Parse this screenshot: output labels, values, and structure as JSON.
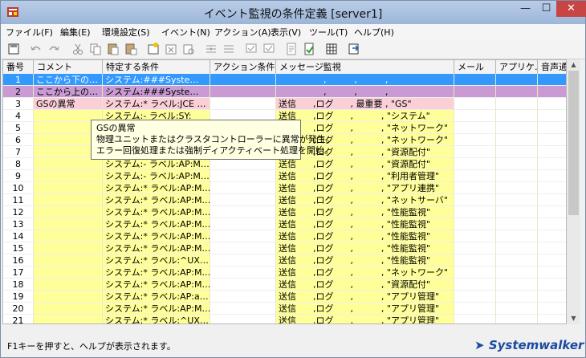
{
  "window": {
    "title": "イベント監視の条件定義 [server1]",
    "min": "—",
    "max": "☐",
    "close": "✕"
  },
  "menu": [
    "ファイル(F)",
    "編集(E)",
    "環境設定(S)",
    "イベント(N)",
    "アクション(A)",
    "表示(V)",
    "ツール(T)",
    "ヘルプ(H)"
  ],
  "toolbar_icons": [
    "save-icon",
    "undo-icon",
    "redo-icon",
    "cut-icon",
    "copy-icon",
    "paste-icon",
    "paste-special-icon",
    "new-condition-icon",
    "delete-icon",
    "find-icon",
    "insert-row-icon",
    "move-row-icon",
    "check-icon",
    "check-all-icon",
    "action-icon",
    "filter-icon",
    "table-icon",
    "export-icon"
  ],
  "columns": [
    "番号",
    "コメント",
    "特定する条件",
    "アクション条件",
    "メッセージ監視",
    "メール",
    "アプリケ…",
    "音声通"
  ],
  "rows": [
    {
      "no": "1",
      "comment": "ここから下の…",
      "cond": "システム:###Syste…",
      "action": "",
      "msg": "                ,          ,          ,",
      "style": "sel-blue"
    },
    {
      "no": "2",
      "comment": "ここから上の…",
      "cond": "システム:###Syste…",
      "action": "",
      "msg": "                ,          ,          ,",
      "style": "sel-purple"
    },
    {
      "no": "3",
      "comment": "GSの異常",
      "cond": "システム:* ラベル:JCE …",
      "action": "",
      "msg": "送信      ,ログ      , 最重要 , \"GS\"",
      "style": "pink"
    },
    {
      "no": "4",
      "comment": "",
      "cond": "システム:- ラベル:SY:",
      "action": "",
      "msg": "送信      ,ログ      ,          , \"システム\"",
      "style": "yellow"
    },
    {
      "no": "5",
      "comment": "",
      "cond": "",
      "action": "",
      "msg": "送信      ,ログ      ,          , \"ネットワーク\"",
      "style": "yellow"
    },
    {
      "no": "6",
      "comment": "",
      "cond": "",
      "action": "",
      "msg": "送信      ,ログ      ,          , \"ネットワーク\"",
      "style": "yellow"
    },
    {
      "no": "7",
      "comment": "",
      "cond": "",
      "action": "",
      "msg": "送信      ,ログ      ,          , \"資源配付\"",
      "style": "yellow"
    },
    {
      "no": "8",
      "comment": "",
      "cond": "システム:- ラベル:AP:M…",
      "action": "",
      "msg": "送信      ,ログ      ,          , \"資源配付\"",
      "style": "yellow"
    },
    {
      "no": "9",
      "comment": "",
      "cond": "システム:- ラベル:AP:M…",
      "action": "",
      "msg": "送信      ,ログ      ,          , \"利用者管理\"",
      "style": "yellow"
    },
    {
      "no": "10",
      "comment": "",
      "cond": "システム:* ラベル:AP:M…",
      "action": "",
      "msg": "送信      ,ログ      ,          , \"アプリ連携\"",
      "style": "yellow"
    },
    {
      "no": "11",
      "comment": "",
      "cond": "システム:* ラベル:AP:M…",
      "action": "",
      "msg": "送信      ,ログ      ,          , \"ネットサーバ\"",
      "style": "yellow"
    },
    {
      "no": "12",
      "comment": "",
      "cond": "システム:* ラベル:AP:M…",
      "action": "",
      "msg": "送信      ,ログ      ,          , \"性能監視\"",
      "style": "yellow"
    },
    {
      "no": "13",
      "comment": "",
      "cond": "システム:* ラベル:AP:M…",
      "action": "",
      "msg": "送信      ,ログ      ,          , \"性能監視\"",
      "style": "yellow"
    },
    {
      "no": "14",
      "comment": "",
      "cond": "システム:* ラベル:AP:M…",
      "action": "",
      "msg": "送信      ,ログ      ,          , \"性能監視\"",
      "style": "yellow"
    },
    {
      "no": "15",
      "comment": "",
      "cond": "システム:* ラベル:AP:M…",
      "action": "",
      "msg": "送信      ,ログ      ,          , \"性能監視\"",
      "style": "yellow"
    },
    {
      "no": "16",
      "comment": "",
      "cond": "システム:* ラベル:^UX…",
      "action": "",
      "msg": "送信      ,ログ      ,          , \"性能監視\"",
      "style": "yellow"
    },
    {
      "no": "17",
      "comment": "",
      "cond": "システム:* ラベル:AP:M…",
      "action": "",
      "msg": "送信      ,ログ      ,          , \"ネットワーク\"",
      "style": "yellow"
    },
    {
      "no": "18",
      "comment": "",
      "cond": "システム:* ラベル:AP:M…",
      "action": "",
      "msg": "送信      ,ログ      ,          , \"資源配付\"",
      "style": "yellow"
    },
    {
      "no": "19",
      "comment": "",
      "cond": "システム:* ラベル:AP:a…",
      "action": "",
      "msg": "送信      ,ログ      ,          , \"アプリ管理\"",
      "style": "yellow"
    },
    {
      "no": "20",
      "comment": "",
      "cond": "システム:* ラベル:AP:M…",
      "action": "",
      "msg": "送信      ,ログ      ,          , \"アプリ管理\"",
      "style": "yellow"
    },
    {
      "no": "21",
      "comment": "",
      "cond": "システム:* ラベル:^UX…",
      "action": "",
      "msg": "送信      ,ログ      ,          , \"アプリ管理\"",
      "style": "yellow"
    }
  ],
  "tooltip": {
    "line1": "GSの異常",
    "line2": "物理ユニットまたはクラスタコントローラーに異常が発生。",
    "line3": "エラー回復処理または強制ディアクティベート処理を開始。"
  },
  "status": {
    "text": "F1キーを押すと、ヘルプが表示されます。",
    "logo": "Systemwalker"
  },
  "colors": {
    "sel_blue": "#3399ff",
    "sel_purple": "#c99ad3",
    "pink": "#fbcfd6",
    "yellow": "#ffff99",
    "header_bg": "#f3f3f3"
  }
}
